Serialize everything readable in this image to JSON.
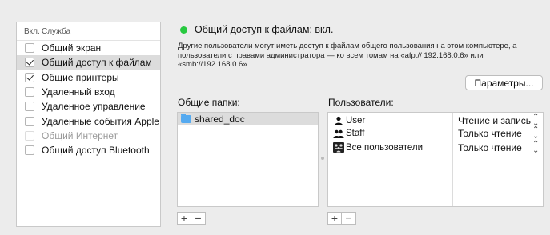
{
  "services_table": {
    "header_on": "Вкл.",
    "header_service": "Служба",
    "rows": [
      {
        "label": "Общий экран",
        "checked": false,
        "selected": false,
        "dim": false
      },
      {
        "label": "Общий доступ к файлам",
        "checked": true,
        "selected": true,
        "dim": false
      },
      {
        "label": "Общие принтеры",
        "checked": true,
        "selected": false,
        "dim": false
      },
      {
        "label": "Удаленный вход",
        "checked": false,
        "selected": false,
        "dim": false
      },
      {
        "label": "Удаленное управление",
        "checked": false,
        "selected": false,
        "dim": false
      },
      {
        "label": "Удаленные события Apple",
        "checked": false,
        "selected": false,
        "dim": false
      },
      {
        "label": "Общий Интернет",
        "checked": false,
        "selected": false,
        "dim": true
      },
      {
        "label": "Общий доступ Bluetooth",
        "checked": false,
        "selected": false,
        "dim": false
      }
    ]
  },
  "status": {
    "text": "Общий доступ к файлам: вкл.",
    "color": "#27c93f"
  },
  "description": "Другие пользователи могут иметь доступ к файлам общего пользования на этом компьютере, а пользователи с правами администратора — ко всем томам на «afp:// 192.168.0.6» или «smb://192.168.0.6».",
  "options_button": "Параметры...",
  "folders": {
    "label": "Общие папки:",
    "items": [
      "shared_doc"
    ],
    "add": "+",
    "remove": "−"
  },
  "users": {
    "label": "Пользователи:",
    "items": [
      {
        "name": "User",
        "icon": "single-user-icon",
        "permission": "Чтение и запись"
      },
      {
        "name": "Staff",
        "icon": "group-icon",
        "permission": "Только чтение"
      },
      {
        "name": "Все пользователи",
        "icon": "everyone-icon",
        "permission": "Только чтение"
      }
    ],
    "add": "+",
    "remove": "−"
  }
}
